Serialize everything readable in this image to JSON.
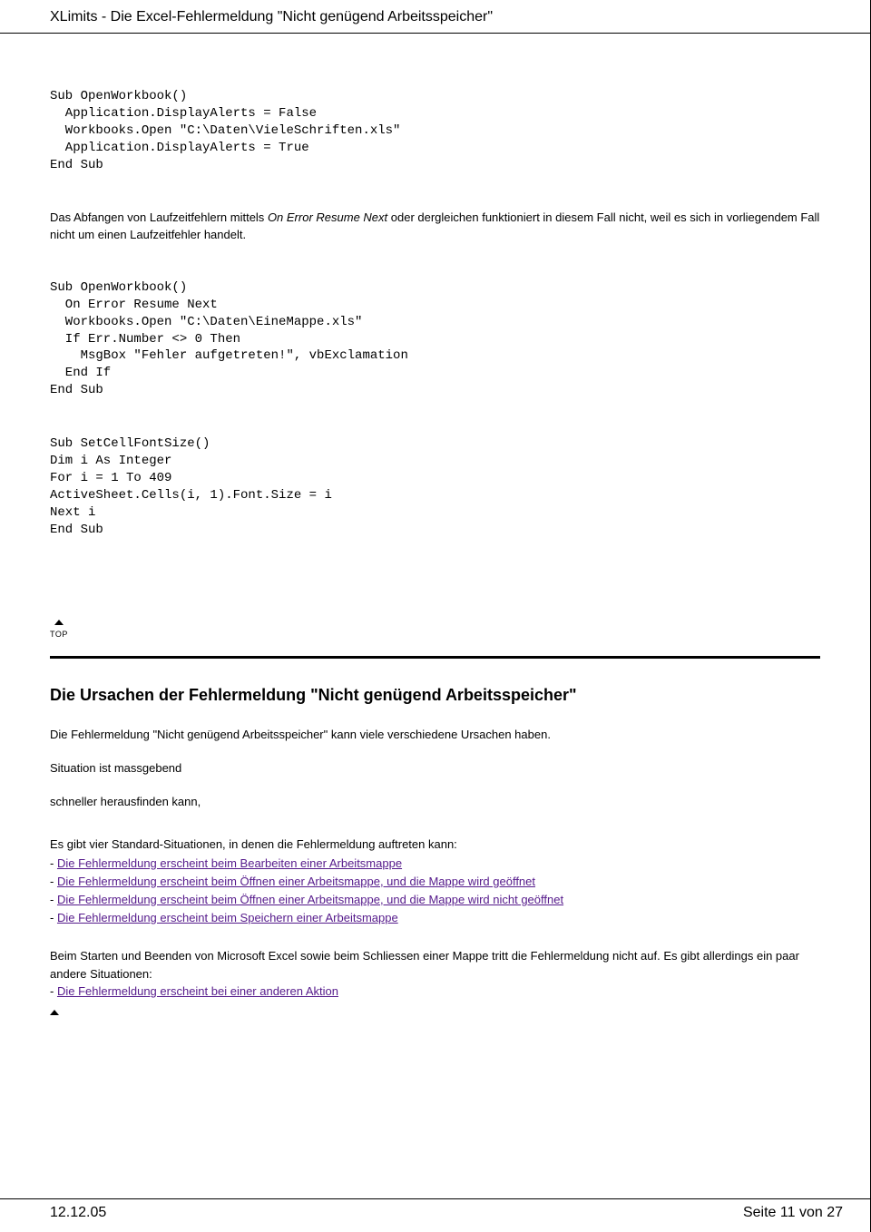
{
  "header": {
    "title": "XLimits - Die Excel-Fehlermeldung \"Nicht genügend Arbeitsspeicher\""
  },
  "code1": "Sub OpenWorkbook()\n  Application.DisplayAlerts = False\n  Workbooks.Open \"C:\\Daten\\VieleSchriften.xls\"\n  Application.DisplayAlerts = True\nEnd Sub",
  "para1_pre": "Das Abfangen von Laufzeitfehlern mittels ",
  "para1_italic": "On Error Resume Next",
  "para1_post": " oder dergleichen funktioniert in diesem Fall nicht, weil es sich in vorliegendem Fall nicht um einen Laufzeitfehler handelt.",
  "code2": "Sub OpenWorkbook()\n  On Error Resume Next\n  Workbooks.Open \"C:\\Daten\\EineMappe.xls\"\n  If Err.Number <> 0 Then\n    MsgBox \"Fehler aufgetreten!\", vbExclamation\n  End If\nEnd Sub",
  "code3": "Sub SetCellFontSize()\nDim i As Integer\nFor i = 1 To 409\nActiveSheet.Cells(i, 1).Font.Size = i\nNext i\nEnd Sub",
  "top_label": "TOP",
  "heading": "Die Ursachen der Fehlermeldung \"Nicht genügend Arbeitsspeicher\"",
  "intro": "Die Fehlermeldung \"Nicht genügend Arbeitsspeicher\" kann viele verschiedene Ursachen haben.",
  "line_situation": "Situation ist massgebend",
  "line_schneller": "schneller herausfinden kann,",
  "situations": {
    "lead": "Es gibt vier Standard-Situationen, in denen die Fehlermeldung auftreten kann:",
    "items": [
      "Die Fehlermeldung erscheint beim Bearbeiten einer Arbeitsmappe",
      "Die Fehlermeldung erscheint beim Öffnen einer Arbeitsmappe, und die Mappe wird geöffnet",
      "Die Fehlermeldung erscheint beim Öffnen einer Arbeitsmappe, und die Mappe wird nicht geöffnet",
      "Die Fehlermeldung erscheint beim Speichern einer Arbeitsmappe"
    ]
  },
  "followup": {
    "text": "Beim Starten und Beenden von Microsoft Excel sowie beim Schliessen einer Mappe tritt die Fehlermeldung nicht auf. Es gibt allerdings ein paar andere Situationen:",
    "link": "Die Fehlermeldung erscheint bei einer anderen Aktion"
  },
  "footer": {
    "date": "12.12.05",
    "page": "Seite 11 von 27"
  }
}
